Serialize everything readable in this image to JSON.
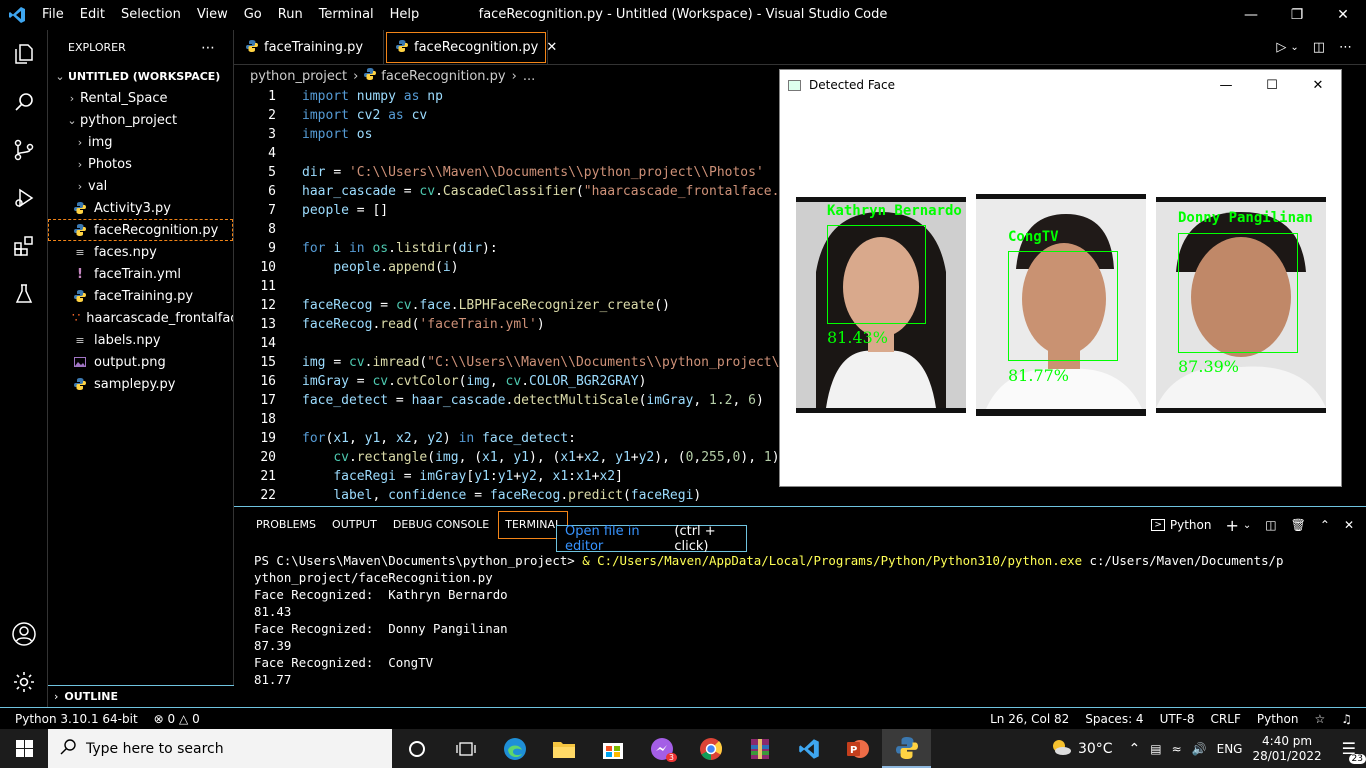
{
  "window": {
    "title": "faceRecognition.py - Untitled (Workspace) - Visual Studio Code",
    "menu": [
      "File",
      "Edit",
      "Selection",
      "View",
      "Go",
      "Run",
      "Terminal",
      "Help"
    ]
  },
  "sidebar": {
    "header": "EXPLORER",
    "workspace": "UNTITLED (WORKSPACE)",
    "items": [
      {
        "label": "Rental_Space",
        "icon": "chevron-right-icon"
      },
      {
        "label": "python_project",
        "icon": "chevron-down-icon"
      },
      {
        "label": "img",
        "icon": "chevron-right-icon"
      },
      {
        "label": "Photos",
        "icon": "chevron-right-icon"
      },
      {
        "label": "val",
        "icon": "chevron-right-icon"
      },
      {
        "label": "Activity3.py",
        "icon": "python-file-icon"
      },
      {
        "label": "faceRecognition.py",
        "icon": "python-file-icon"
      },
      {
        "label": "faces.npy",
        "icon": "text-file-icon"
      },
      {
        "label": "faceTrain.yml",
        "icon": "yaml-file-icon"
      },
      {
        "label": "faceTraining.py",
        "icon": "python-file-icon"
      },
      {
        "label": "haarcascade_frontalfac...",
        "icon": "xml-file-icon"
      },
      {
        "label": "labels.npy",
        "icon": "text-file-icon"
      },
      {
        "label": "output.png",
        "icon": "image-file-icon"
      },
      {
        "label": "samplepy.py",
        "icon": "python-file-icon"
      }
    ],
    "outline": "OUTLINE"
  },
  "tabs": [
    {
      "label": "faceTraining.py"
    },
    {
      "label": "faceRecognition.py"
    }
  ],
  "breadcrumb": {
    "folder": "python_project",
    "file": "faceRecognition.py",
    "more": "..."
  },
  "code": {
    "line_numbers": [
      "1",
      "2",
      "3",
      "4",
      "5",
      "6",
      "7",
      "8",
      "9",
      "10",
      "11",
      "12",
      "13",
      "14",
      "15",
      "16",
      "17",
      "18",
      "19",
      "20",
      "21",
      "22"
    ],
    "lines": [
      "import numpy as np",
      "import cv2 as cv",
      "import os",
      "",
      "dir = 'C:\\\\Users\\\\Maven\\\\Documents\\\\python_project\\\\Photos'",
      "haar_cascade = cv.CascadeClassifier(\"haarcascade_frontalface.x",
      "people = []",
      "",
      "for i in os.listdir(dir):",
      "    people.append(i)",
      "",
      "faceRecog = cv.face.LBPHFaceRecognizer_create()",
      "faceRecog.read('faceTrain.yml')",
      "",
      "img = cv.imread(\"C:\\\\Users\\\\Maven\\\\Documents\\\\python_project\\\\",
      "imGray = cv.cvtColor(img, cv.COLOR_BGR2GRAY)",
      "face_detect = haar_cascade.detectMultiScale(imGray, 1.2, 6)",
      "",
      "for(x1, y1, x2, y2) in face_detect:",
      "    cv.rectangle(img, (x1, y1), (x1+x2, y1+y2), (0,255,0), 1)",
      "    faceRegi = imGray[y1:y1+y2, x1:x1+x2]",
      "    label, confidence = faceRecog.predict(faceRegi)"
    ]
  },
  "panel": {
    "tabs": [
      "PROBLEMS",
      "OUTPUT",
      "DEBUG CONSOLE",
      "TERMINAL"
    ],
    "shell": "Python",
    "tooltip_link": "Open file in editor",
    "tooltip_hint": "(ctrl + click)",
    "terminal": {
      "prompt": "PS C:\\Users\\Maven\\Documents\\python_project> ",
      "amp": "& ",
      "exe": "C:/Users/Maven/AppData/Local/Programs/Python/Python310/python.exe",
      "arg": " c:/Users/Maven/Documents/p",
      "wrap": "ython_project/faceRecognition.py",
      "output": [
        "Face Recognized:  Kathryn Bernardo",
        "81.43",
        "Face Recognized:  Donny Pangilinan",
        "87.39",
        "Face Recognized:  CongTV",
        "81.77"
      ]
    }
  },
  "status": {
    "interpreter": "Python 3.10.1 64-bit",
    "problems": "0",
    "warnings": "0",
    "position": "Ln 26, Col 82",
    "spaces": "Spaces: 4",
    "encoding": "UTF-8",
    "eol": "CRLF",
    "language": "Python"
  },
  "face_window": {
    "title": "Detected Face",
    "faces": [
      {
        "name": "Kathryn Bernardo",
        "confidence": "81.43%"
      },
      {
        "name": "CongTV",
        "confidence": "81.77%"
      },
      {
        "name": "Donny Pangilinan",
        "confidence": "87.39%"
      }
    ]
  },
  "taskbar": {
    "search_placeholder": "Type here to search",
    "weather": "30°C",
    "language": "ENG",
    "time": "4:40 pm",
    "date": "28/01/2022",
    "notifications": "23",
    "badge": "3"
  },
  "colors": {
    "accent": "#f38518",
    "border": "#6fc3df",
    "green": "#00ff00",
    "python_blue": "#3b78b0"
  }
}
